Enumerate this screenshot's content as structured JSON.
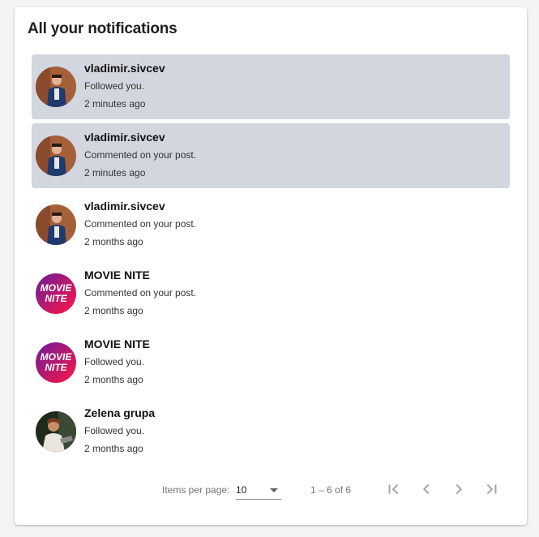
{
  "title": "All your notifications",
  "notifications": [
    {
      "user": "vladimir.sivcev",
      "message": "Followed you.",
      "time": "2 minutes ago",
      "unread": true,
      "avatar": "person-photo"
    },
    {
      "user": "vladimir.sivcev",
      "message": "Commented on your post.",
      "time": "2 minutes ago",
      "unread": true,
      "avatar": "person-photo"
    },
    {
      "user": "vladimir.sivcev",
      "message": "Commented on your post.",
      "time": "2 months ago",
      "unread": false,
      "avatar": "person-photo"
    },
    {
      "user": "MOVIE NITE",
      "message": "Commented on your post.",
      "time": "2 months ago",
      "unread": false,
      "avatar": "movie-nite-logo"
    },
    {
      "user": "MOVIE NITE",
      "message": "Followed you.",
      "time": "2 months ago",
      "unread": false,
      "avatar": "movie-nite-logo"
    },
    {
      "user": "Zelena grupa",
      "message": "Followed you.",
      "time": "2 months ago",
      "unread": false,
      "avatar": "group-photo"
    }
  ],
  "logo_text": [
    "MOVIE",
    "NITE"
  ],
  "paginator": {
    "items_per_page_label": "Items per page:",
    "items_per_page_value": "10",
    "range_label": "1 – 6 of 6",
    "first_icon": "first-page-icon",
    "prev_icon": "chevron-left-icon",
    "next_icon": "chevron-right-icon",
    "last_icon": "last-page-icon"
  },
  "colors": {
    "unread_bg": "#d2d6df",
    "card_bg": "#ffffff",
    "page_bg": "#f4f4f4"
  }
}
